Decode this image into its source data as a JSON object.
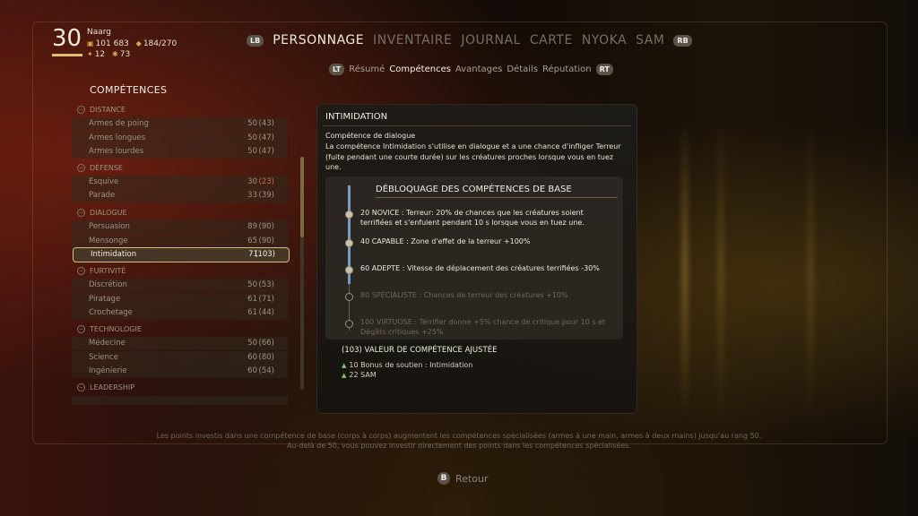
{
  "player": {
    "level": "30",
    "name": "Naarg",
    "money": "101 683",
    "carry": "184/270",
    "stat_a": "12",
    "stat_b": "73"
  },
  "nav": {
    "lb": "LB",
    "rb": "RB",
    "tabs": [
      "PERSONNAGE",
      "INVENTAIRE",
      "JOURNAL",
      "CARTE",
      "NYOKA",
      "SAM"
    ]
  },
  "subnav": {
    "lt": "LT",
    "rt": "RT",
    "tabs": [
      "Résumé",
      "Compétences",
      "Avantages",
      "Détails",
      "Réputation"
    ]
  },
  "skills_panel": {
    "title": "COMPÉTENCES",
    "categories": [
      {
        "name": "DISTANCE",
        "rows": [
          {
            "label": "Armes de poing",
            "value": "50",
            "base": "(43)"
          },
          {
            "label": "Armes longues",
            "value": "50",
            "base": "(47)"
          },
          {
            "label": "Armes lourdes",
            "value": "50",
            "base": "(47)"
          }
        ]
      },
      {
        "name": "DÉFENSE",
        "rows": [
          {
            "label": "Esquive",
            "value": "30",
            "base": "(23)"
          },
          {
            "label": "Parade",
            "value": "33",
            "base": "(39)"
          }
        ]
      },
      {
        "name": "DIALOGUE",
        "rows": [
          {
            "label": "Persuasion",
            "value": "89",
            "base": "(90)"
          },
          {
            "label": "Mensonge",
            "value": "65",
            "base": "(90)"
          },
          {
            "label": "Intimidation",
            "value": "71",
            "base": "(103)"
          }
        ]
      },
      {
        "name": "FURTIVITÉ",
        "rows": [
          {
            "label": "Discrétion",
            "value": "50",
            "base": "(53)"
          },
          {
            "label": "Piratage",
            "value": "61",
            "base": "(71)"
          },
          {
            "label": "Crochetage",
            "value": "61",
            "base": "(44)"
          }
        ]
      },
      {
        "name": "TECHNOLOGIE",
        "rows": [
          {
            "label": "Médecine",
            "value": "50",
            "base": "(66)"
          },
          {
            "label": "Science",
            "value": "60",
            "base": "(80)"
          },
          {
            "label": "Ingénierie",
            "value": "60",
            "base": "(54)"
          }
        ]
      },
      {
        "name": "LEADERSHIP",
        "rows": []
      }
    ]
  },
  "detail": {
    "title": "INTIMIDATION",
    "subtitle": "Compétence de dialogue",
    "description": "La compétence Intimidation s'utilise en dialogue et a une chance d'infliger Terreur (fuite pendant une courte durée) sur les créatures proches lorsque vous en tuez une.",
    "unlock_title": "DÉBLOQUAGE DES COMPÉTENCES DE BASE",
    "tiers": [
      {
        "text": "20 NOVICE : Terreur: 20% de chances que les créatures soient terrifiées et s'enfuient pendant 10 s lorsque vous en tuez une.",
        "unlocked": true
      },
      {
        "text": "40 CAPABLE : Zone d'effet de la terreur +100%",
        "unlocked": true
      },
      {
        "text": "60 ADEPTE : Vitesse de déplacement des créatures terrifiées -30%",
        "unlocked": true
      },
      {
        "text": "80 SPÉCIALISTE : Chances de terreur des créatures +10%",
        "unlocked": false
      },
      {
        "text": "100 VIRTUOSE : Terrifier donne +5% chance de critique pour 10 s et Dégâts critiques +25%",
        "unlocked": false
      }
    ],
    "adjusted": "(103) VALEUR DE COMPÉTENCE AJUSTÉE",
    "bonuses": [
      {
        "amount": "10",
        "label": "Bonus de soutien : Intimidation"
      },
      {
        "amount": "22",
        "label": "SAM"
      }
    ]
  },
  "footer": {
    "line1": "Les points investis dans une compétence de base (corps à corps) augmentent les compétences spécialisées (armes à une main, armes à deux mains) jusqu'au rang 50.",
    "line2": "Au-delà de 50, vous pouvez investir directement des points dans les compétences spécialisées."
  },
  "back": {
    "key": "B",
    "label": "Retour"
  }
}
